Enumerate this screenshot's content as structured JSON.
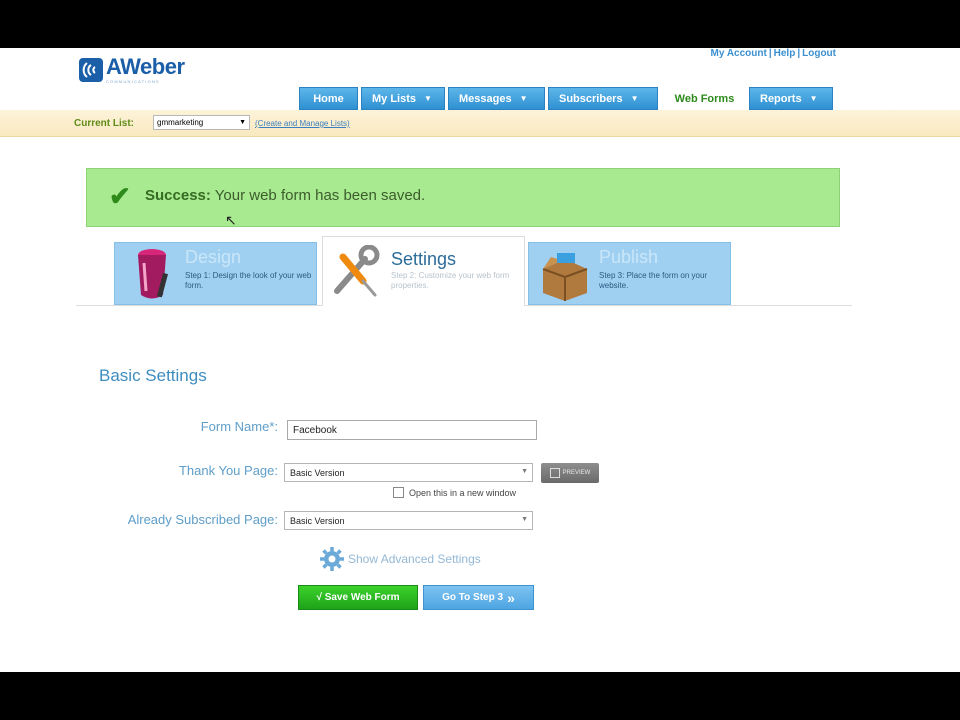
{
  "header": {
    "logo": {
      "word": "AWeber",
      "sub": "COMMUNICATIONS"
    },
    "toplinks": [
      "My Account",
      "Help",
      "Logout"
    ],
    "toplink_separator": "|"
  },
  "nav": {
    "home": "Home",
    "my_lists": "My Lists",
    "messages": "Messages",
    "subscribers": "Subscribers",
    "web_forms": "Web Forms",
    "reports": "Reports",
    "active": "Web Forms"
  },
  "list_bar": {
    "label": "Current List:",
    "selected_list": "gmmarketing",
    "manage_link": "(Create and Manage Lists)"
  },
  "alert": {
    "title": "Success:",
    "message": "Your web form has been saved."
  },
  "steps": [
    {
      "title": "Design",
      "desc": "Step 1: Design the look of your web form."
    },
    {
      "title": "Settings",
      "desc": "Step 2: Customize your web form properties."
    },
    {
      "title": "Publish",
      "desc": "Step 3: Place the form on your website."
    }
  ],
  "form": {
    "section_title": "Basic Settings",
    "form_name_label": "Form Name*:",
    "form_name_value": "Facebook",
    "thank_you_label": "Thank You Page:",
    "thank_you_value": "Basic Version",
    "preview_label": "PREVIEW",
    "new_window_label": "Open this in a new window",
    "already_label": "Already Subscribed Page:",
    "already_value": "Basic Version",
    "advanced_label": "Show Advanced Settings",
    "save_label": "√ Save Web Form",
    "next_label": "Go To Step 3"
  },
  "colors": {
    "nav_blue": "#3a9ee0",
    "success_bg": "#a8ea90",
    "save_green": "#22b61d",
    "next_blue": "#5aafea",
    "label_blue": "#5f9ec9"
  }
}
